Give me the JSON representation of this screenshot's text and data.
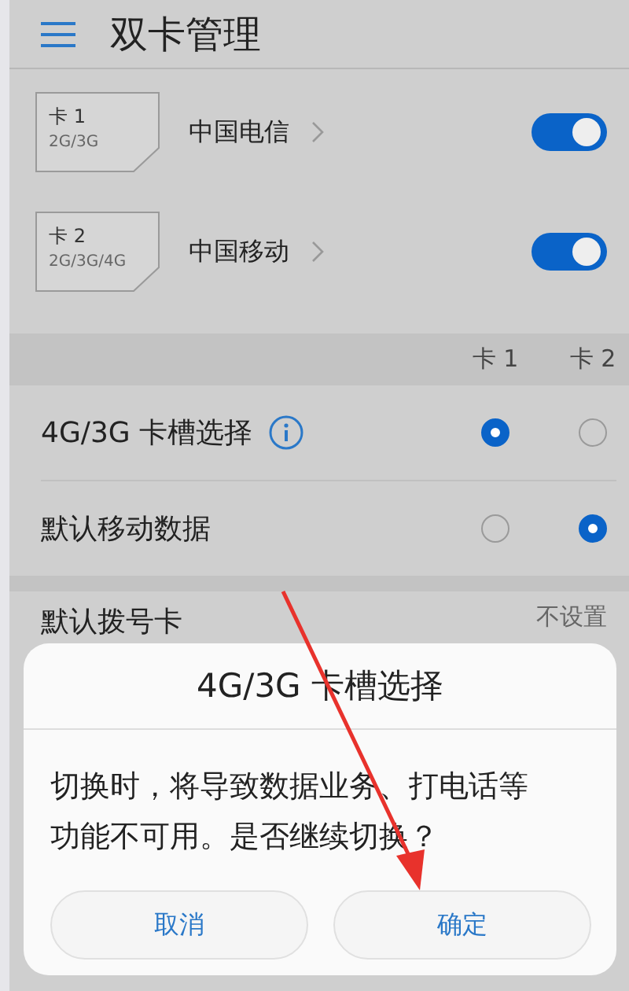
{
  "header": {
    "title": "双卡管理"
  },
  "sims": [
    {
      "slot": "卡 1",
      "networks": "2G/3G",
      "carrier": "中国电信",
      "on": true
    },
    {
      "slot": "卡 2",
      "networks": "2G/3G/4G",
      "carrier": "中国移动",
      "on": true
    }
  ],
  "slot_columns": [
    "卡 1",
    "卡 2"
  ],
  "selections": [
    {
      "label": "4G/3G 卡槽选择",
      "info": true,
      "options": [
        {
          "selected": true
        },
        {
          "selected": false
        }
      ]
    },
    {
      "label": "默认移动数据",
      "info": false,
      "options": [
        {
          "selected": false
        },
        {
          "selected": true
        }
      ]
    }
  ],
  "dial": {
    "label": "默认拨号卡",
    "value": "不设置"
  },
  "dialog": {
    "title": "4G/3G 卡槽选择",
    "message": "切换时，将导致数据业务、打电话等功能不可用。是否继续切换？",
    "buttons": [
      "取消",
      "确定"
    ]
  }
}
